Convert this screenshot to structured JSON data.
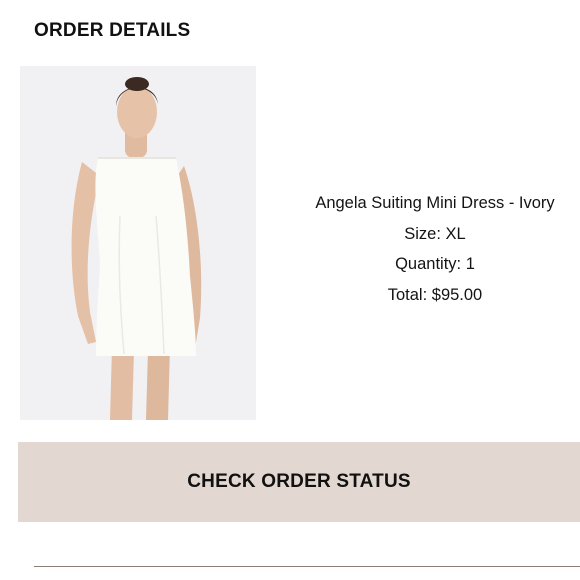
{
  "header": {
    "title": "ORDER DETAILS"
  },
  "product": {
    "image_icon": "product-photo-dress",
    "name": "Angela Suiting Mini Dress - Ivory",
    "size_line": "Size: XL",
    "quantity_line": "Quantity: 1",
    "total_line": "Total: $95.00"
  },
  "actions": {
    "check_status_label": "CHECK ORDER STATUS"
  },
  "colors": {
    "button_bg": "#e3d8d1",
    "photo_bg": "#f1f0f3",
    "divider": "#8c7e76"
  }
}
